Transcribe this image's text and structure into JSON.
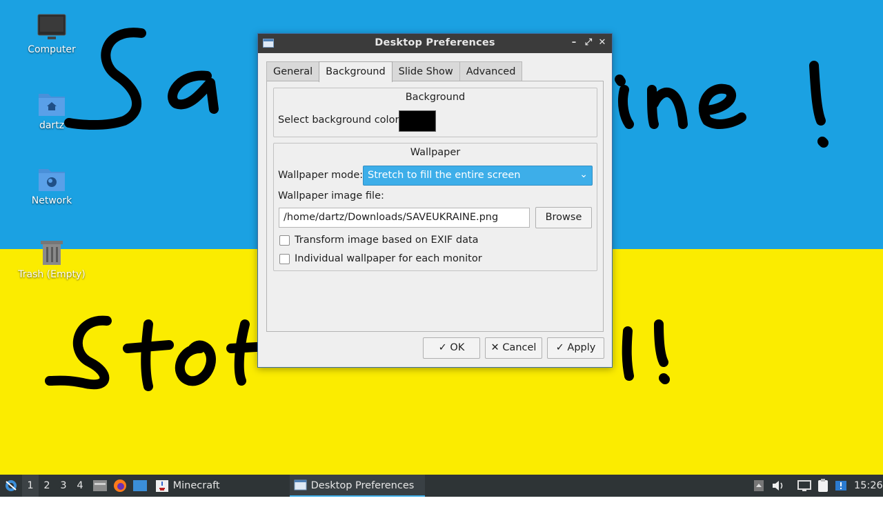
{
  "desktop": {
    "icons": [
      {
        "label": "Computer",
        "icon": "computer-icon"
      },
      {
        "label": "dartz",
        "icon": "home-folder-icon"
      },
      {
        "label": "Network",
        "icon": "network-folder-icon"
      },
      {
        "label": "Trash (Empty)",
        "icon": "trash-icon"
      }
    ],
    "wallpaper_colors": {
      "top": "#1ba1e2",
      "bottom": "#fbec00",
      "ink": "#000000"
    }
  },
  "dialog": {
    "title": "Desktop Preferences",
    "controls": {
      "minimize": "–",
      "maximize": "⤢",
      "close": "✕"
    },
    "tabs": [
      "General",
      "Background",
      "Slide Show",
      "Advanced"
    ],
    "active_tab": "Background",
    "background_group": {
      "title": "Background",
      "color_label": "Select background color:",
      "color_value": "#000000"
    },
    "wallpaper_group": {
      "title": "Wallpaper",
      "mode_label": "Wallpaper mode:",
      "mode_value": "Stretch to fill the entire screen",
      "file_label": "Wallpaper image file:",
      "file_value": "/home/dartz/Downloads/SAVEUKRAINE.png",
      "browse_label": "Browse",
      "exif_label": "Transform image based on EXIF data",
      "exif_checked": false,
      "per_monitor_label": "Individual wallpaper for each monitor",
      "per_monitor_checked": false
    },
    "buttons": {
      "ok": "OK",
      "cancel": "Cancel",
      "apply": "Apply"
    },
    "accent_color": "#3daee9"
  },
  "taskbar": {
    "desktops": [
      "1",
      "2",
      "3",
      "4"
    ],
    "active_desktop": "1",
    "launchers": [
      "file-manager-icon",
      "firefox-icon",
      "show-desktop-icon"
    ],
    "windows": [
      {
        "label": "Minecraft",
        "icon": "java-icon",
        "active": false
      },
      {
        "label": "Desktop Preferences",
        "icon": "window-icon",
        "active": true
      }
    ],
    "tray": [
      "tray-arrow-icon",
      "volume-icon",
      "network-icon",
      "clipboard-icon",
      "updates-icon"
    ],
    "clock": "15:26"
  }
}
